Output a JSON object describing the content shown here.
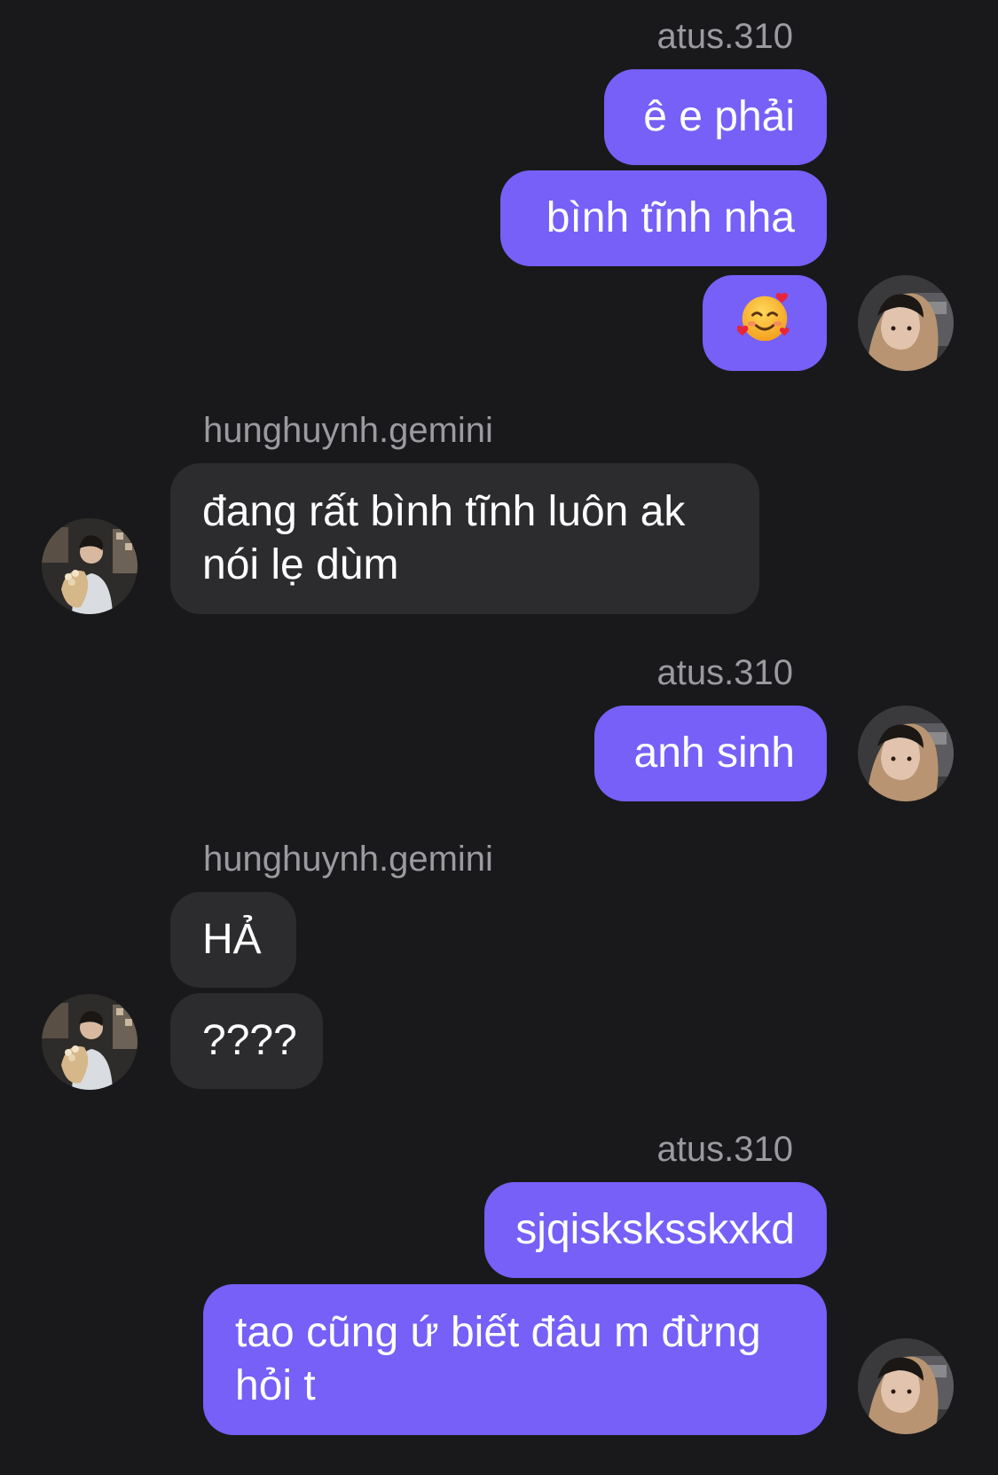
{
  "users": {
    "me": {
      "username": "atus.310",
      "avatar_icon": "profile-photo-hoodie"
    },
    "them": {
      "username": "hunghuynh.gemini",
      "avatar_icon": "profile-photo-flowers"
    }
  },
  "colors": {
    "background": "#19191b",
    "outgoing_bubble": "#7660f7",
    "incoming_bubble": "#2c2c2f",
    "username_text": "#9a9aa0"
  },
  "messages": {
    "g1_sender": "atus.310",
    "m1": "ê e phải",
    "m2": "bình tĩnh nha",
    "m3_emoji": "smiling-face-with-hearts",
    "g2_sender": "hunghuynh.gemini",
    "m4_line1": "đang rất bình tĩnh luôn ak",
    "m4_line2": "nói lẹ dùm",
    "g3_sender": "atus.310",
    "m5": "anh sinh",
    "g4_sender": "hunghuynh.gemini",
    "m6": "HẢ",
    "m7": "????",
    "g5_sender": "atus.310",
    "m8": "sjqisksksskxkd",
    "m9_line1": "tao cũng ứ biết đâu m đừng",
    "m9_line2": "hỏi t"
  }
}
